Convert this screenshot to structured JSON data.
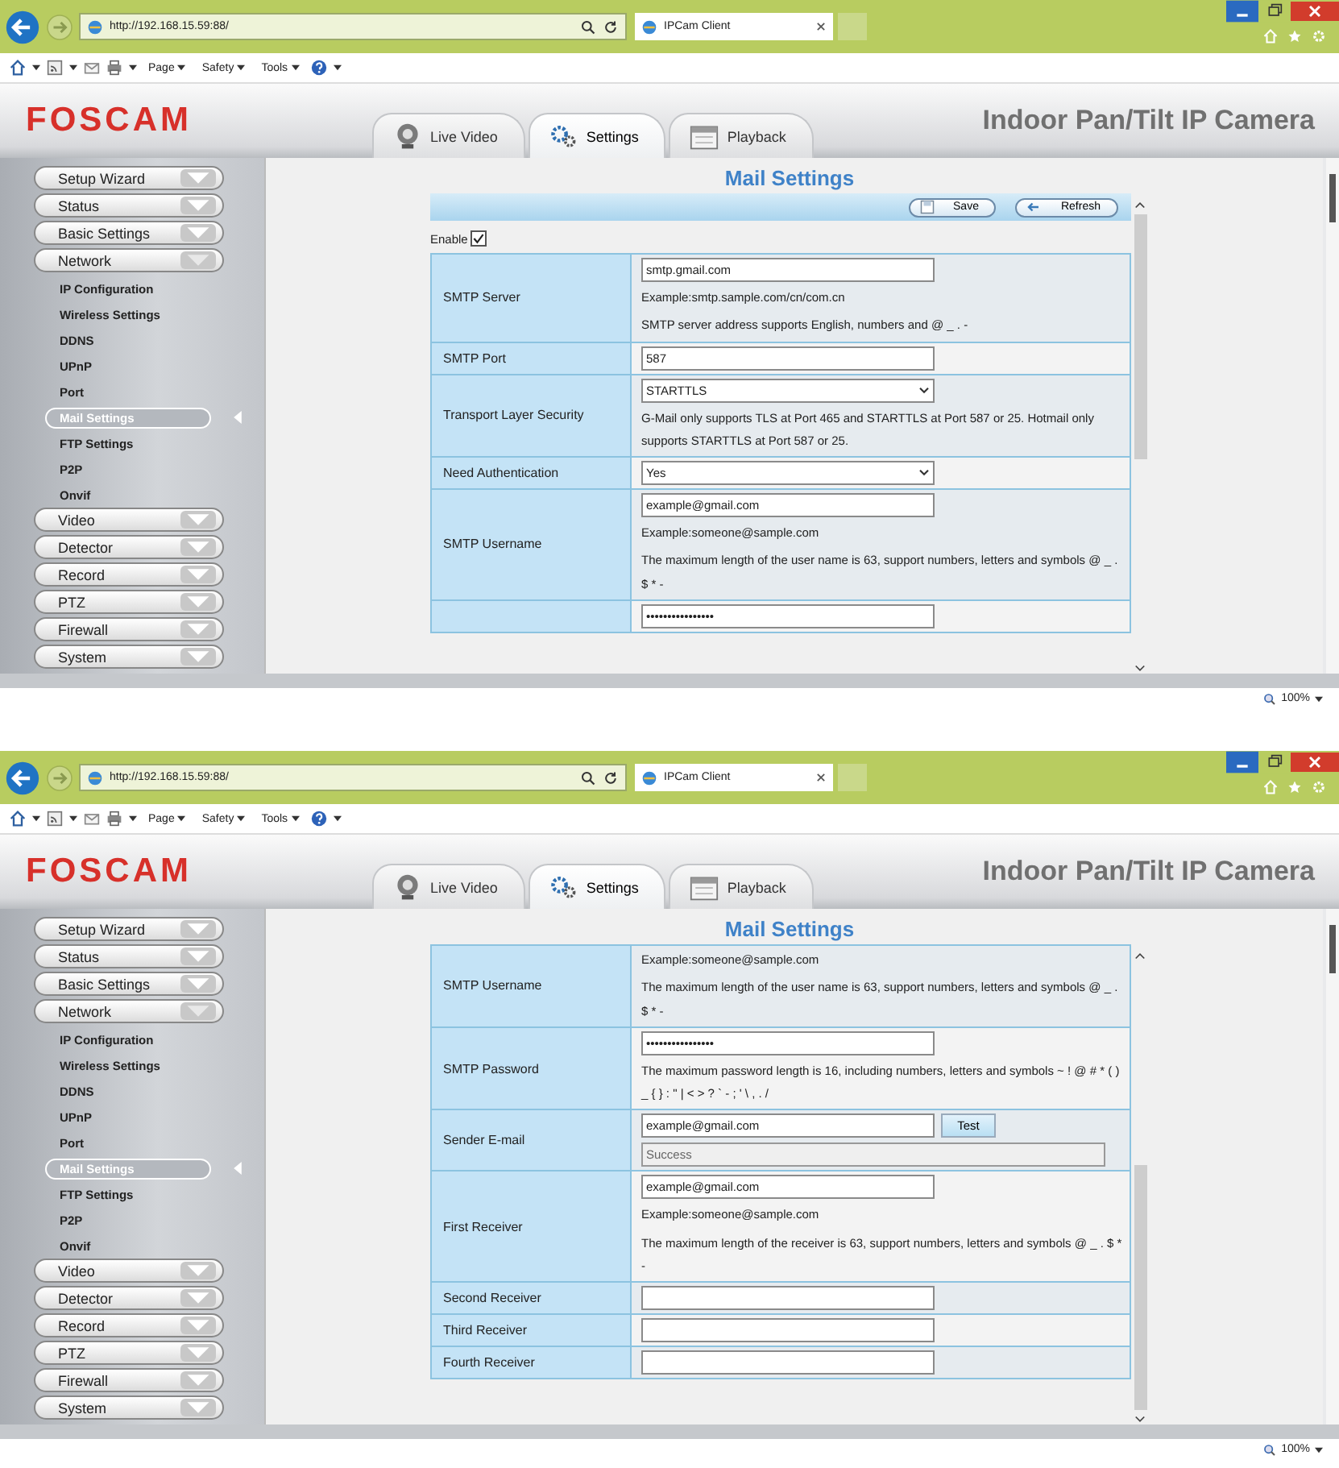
{
  "screens": [
    {
      "browser": {
        "address": "http://192.168.15.59:88/",
        "tab_title": "IPCam Client",
        "commands": [
          "Page",
          "Safety",
          "Tools"
        ],
        "zoom": "100%"
      },
      "header": {
        "logo": "FOSCAM",
        "title": "Indoor Pan/Tilt IP Camera",
        "tabs": [
          {
            "label": "Live Video",
            "kind": "video",
            "selected": false
          },
          {
            "label": "Settings",
            "kind": "settings",
            "selected": true
          },
          {
            "label": "Playback",
            "kind": "playback",
            "selected": false
          }
        ]
      },
      "sidebar": [
        {
          "label": "Setup Wizard",
          "expanded": false
        },
        {
          "label": "Status",
          "expanded": false
        },
        {
          "label": "Basic Settings",
          "expanded": false
        },
        {
          "label": "Network",
          "expanded": true,
          "children": [
            {
              "label": "IP Configuration",
              "selected": false
            },
            {
              "label": "Wireless Settings",
              "selected": false
            },
            {
              "label": "DDNS",
              "selected": false
            },
            {
              "label": "UPnP",
              "selected": false
            },
            {
              "label": "Port",
              "selected": false
            },
            {
              "label": "Mail Settings",
              "selected": true
            },
            {
              "label": "FTP Settings",
              "selected": false
            },
            {
              "label": "P2P",
              "selected": false
            },
            {
              "label": "Onvif",
              "selected": false
            }
          ]
        },
        {
          "label": "Video",
          "expanded": false
        },
        {
          "label": "Detector",
          "expanded": false
        },
        {
          "label": "Record",
          "expanded": false
        },
        {
          "label": "PTZ",
          "expanded": false
        },
        {
          "label": "Firewall",
          "expanded": false
        },
        {
          "label": "System",
          "expanded": false
        }
      ],
      "form": {
        "title": "Mail Settings",
        "toolbar": [
          {
            "label": "Save",
            "kind": "save"
          },
          {
            "label": "Refresh",
            "kind": "refresh"
          }
        ],
        "enable": {
          "label": "Enable",
          "checked": true
        },
        "rows": [
          {
            "label": "SMTP Server",
            "items": [
              {
                "kind": "input",
                "value": "smtp.gmail.com"
              },
              {
                "kind": "text",
                "text": "Example:smtp.sample.com/cn/com.cn"
              },
              {
                "kind": "text",
                "text": "SMTP server address supports English, numbers and @ _ . -"
              }
            ]
          },
          {
            "label": "SMTP Port",
            "items": [
              {
                "kind": "input",
                "value": "587"
              }
            ]
          },
          {
            "label": "Transport Layer Security",
            "items": [
              {
                "kind": "select",
                "value": "STARTTLS"
              },
              {
                "kind": "text",
                "text": "G-Mail only supports TLS at Port 465 and STARTTLS at Port 587 or 25. Hotmail only supports STARTTLS at Port 587 or 25."
              }
            ]
          },
          {
            "label": "Need Authentication",
            "items": [
              {
                "kind": "select",
                "value": "Yes"
              }
            ]
          },
          {
            "label": "SMTP Username",
            "items": [
              {
                "kind": "input",
                "value": "example@gmail.com"
              },
              {
                "kind": "text",
                "text": "Example:someone@sample.com"
              },
              {
                "kind": "text",
                "text": "The maximum length of the user name is 63, support numbers, letters and symbols @ _ . $ * -"
              }
            ]
          },
          {
            "items": [
              {
                "kind": "input",
                "value": "••••••••••••••••"
              }
            ]
          }
        ]
      }
    },
    {
      "browser": {
        "address": "http://192.168.15.59:88/",
        "tab_title": "IPCam Client",
        "commands": [
          "Page",
          "Safety",
          "Tools"
        ],
        "zoom": "100%"
      },
      "header": {
        "logo": "FOSCAM",
        "title": "Indoor Pan/Tilt IP Camera",
        "tabs": [
          {
            "label": "Live Video",
            "kind": "video",
            "selected": false
          },
          {
            "label": "Settings",
            "kind": "settings",
            "selected": true
          },
          {
            "label": "Playback",
            "kind": "playback",
            "selected": false
          }
        ]
      },
      "sidebar": [
        {
          "label": "Setup Wizard",
          "expanded": false
        },
        {
          "label": "Status",
          "expanded": false
        },
        {
          "label": "Basic Settings",
          "expanded": false
        },
        {
          "label": "Network",
          "expanded": true,
          "children": [
            {
              "label": "IP Configuration",
              "selected": false
            },
            {
              "label": "Wireless Settings",
              "selected": false
            },
            {
              "label": "DDNS",
              "selected": false
            },
            {
              "label": "UPnP",
              "selected": false
            },
            {
              "label": "Port",
              "selected": false
            },
            {
              "label": "Mail Settings",
              "selected": true
            },
            {
              "label": "FTP Settings",
              "selected": false
            },
            {
              "label": "P2P",
              "selected": false
            },
            {
              "label": "Onvif",
              "selected": false
            }
          ]
        },
        {
          "label": "Video",
          "expanded": false
        },
        {
          "label": "Detector",
          "expanded": false
        },
        {
          "label": "Record",
          "expanded": false
        },
        {
          "label": "PTZ",
          "expanded": false
        },
        {
          "label": "Firewall",
          "expanded": false
        },
        {
          "label": "System",
          "expanded": false
        }
      ],
      "form": {
        "title": "Mail Settings",
        "rows": [
          {
            "label": "SMTP Username",
            "items": [
              {
                "kind": "text",
                "text": "Example:someone@sample.com"
              },
              {
                "kind": "text",
                "text": "The maximum length of the user name is 63, support numbers, letters and symbols @ _ . $ * -"
              }
            ]
          },
          {
            "label": "SMTP Password",
            "items": [
              {
                "kind": "input",
                "value": "••••••••••••••••"
              },
              {
                "kind": "text",
                "text": "The maximum password length is 16, including numbers, letters and symbols ~ ! @ # * ( ) _ { } : \" | < > ? ` - ; ' \\ , . /"
              }
            ]
          },
          {
            "label": "Sender E-mail",
            "items": [
              {
                "kind": "input_button",
                "value": "example@gmail.com",
                "button": "Test"
              },
              {
                "kind": "status",
                "value": "Success"
              }
            ]
          },
          {
            "label": "First Receiver",
            "items": [
              {
                "kind": "input",
                "value": "example@gmail.com"
              },
              {
                "kind": "text",
                "text": "Example:someone@sample.com"
              },
              {
                "kind": "text",
                "text": "The maximum length of the receiver is 63, support numbers, letters and symbols @ _ . $ * -"
              }
            ]
          },
          {
            "label": "Second Receiver",
            "items": [
              {
                "kind": "input"
              }
            ]
          },
          {
            "label": "Third Receiver",
            "items": [
              {
                "kind": "input"
              }
            ]
          },
          {
            "label": "Fourth Receiver",
            "items": [
              {
                "kind": "input"
              }
            ]
          }
        ]
      }
    }
  ]
}
